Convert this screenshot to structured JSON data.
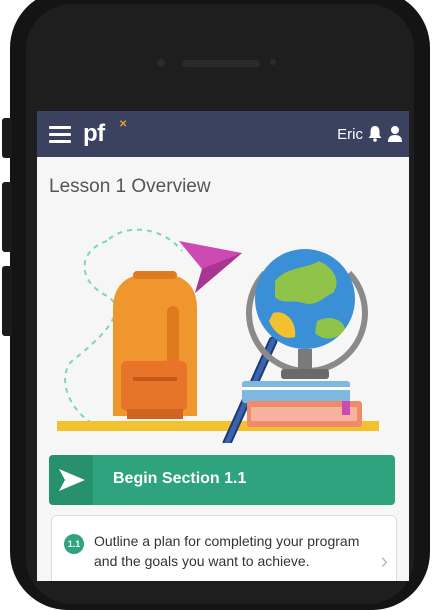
{
  "app": {
    "logo": "pf",
    "user_name": "Eric"
  },
  "page": {
    "title": "Lesson 1 Overview"
  },
  "actions": {
    "begin_label": "Begin Section 1.1"
  },
  "outline": {
    "step_number": "1.1",
    "text": "Outline a plan for completing your program and the goals you want to achieve."
  },
  "icons": {
    "menu": "hamburger-menu-icon",
    "notifications": "bell-icon",
    "profile": "user-icon",
    "begin": "play-arrow-icon",
    "next": "chevron-right-icon"
  },
  "colors": {
    "header": "#3a4260",
    "accent_green": "#2ea37d",
    "logo_mark": "#e0a030"
  }
}
